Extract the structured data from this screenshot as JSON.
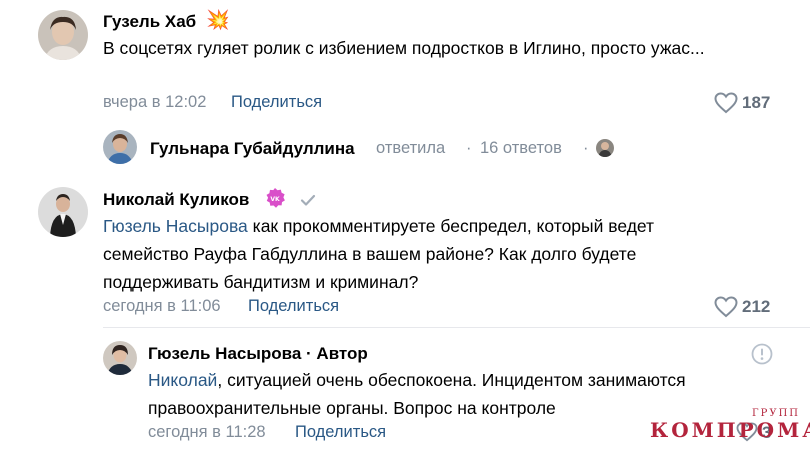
{
  "comment1": {
    "author": "Гузель Хаб",
    "badge_emoji": "💥",
    "text": "В соцсетях гуляет ролик с избиением подростков в Иглино, просто ужас...",
    "time": "вчера в 12:02",
    "share_label": "Поделиться",
    "likes": "187",
    "replies_summary": {
      "author": "Гульнара Губайдуллина",
      "action": "ответила",
      "separator": "·",
      "count": "16 ответов",
      "separator2": "·"
    }
  },
  "comment2": {
    "author": "Николай Куликов",
    "mention": "Гюзель Насырова",
    "text": " как прокомментируете беспредел, который ведет семейство Рауфа Габдуллина в вашем районе? Как долго будете поддерживать бандитизм и криминал?",
    "time": "сегодня в 11:06",
    "share_label": "Поделиться",
    "likes": "212"
  },
  "reply": {
    "author": "Гюзель Насырова · Автор",
    "mention": "Николай",
    "text": ", ситуацией очень обеспокоена. Инцидентом занимаются правоохранительные органы. Вопрос на контроле",
    "time": "сегодня в 11:28",
    "share_label": "Поделиться",
    "likes": "3"
  },
  "watermark": {
    "main": "КОМПРОМАТ",
    "sup": "ГРУПП"
  },
  "colors": {
    "link": "#2a5885",
    "meta": "#818c99",
    "likes": "#626d7a",
    "watermark": "#b3243c"
  },
  "icons": [
    "heart-icon",
    "check-icon",
    "report-icon",
    "vk-badge-icon"
  ]
}
